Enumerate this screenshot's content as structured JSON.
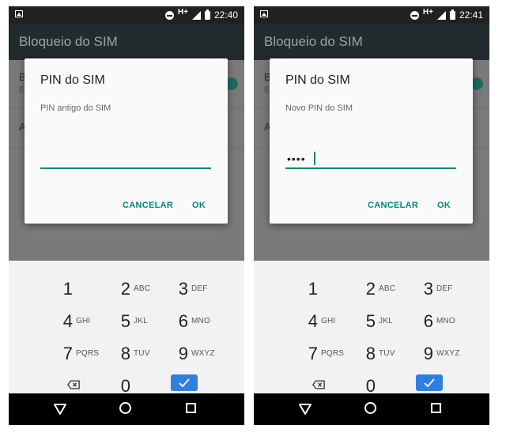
{
  "screens": [
    {
      "status": {
        "network": "H+",
        "time": "22:40"
      },
      "app_title": "Bloqueio do SIM",
      "settings_rows": [
        {
          "title": "B",
          "subtitle": "E"
        },
        {
          "title": "A"
        }
      ],
      "dialog": {
        "title": "PIN do SIM",
        "field_label": "PIN antigo do SIM",
        "input_value": "",
        "cancel_label": "CANCELAR",
        "ok_label": "OK"
      }
    },
    {
      "status": {
        "network": "H+",
        "time": "22:41"
      },
      "app_title": "Bloqueio do SIM",
      "settings_rows": [
        {
          "title": "B",
          "subtitle": "E"
        },
        {
          "title": "A"
        }
      ],
      "dialog": {
        "title": "PIN do SIM",
        "field_label": "Novo PIN do SIM",
        "input_value": "••••",
        "cancel_label": "CANCELAR",
        "ok_label": "OK"
      }
    }
  ],
  "keypad": {
    "keys": [
      {
        "num": "1",
        "letters": ""
      },
      {
        "num": "2",
        "letters": "ABC"
      },
      {
        "num": "3",
        "letters": "DEF"
      },
      {
        "num": "4",
        "letters": "GHI"
      },
      {
        "num": "5",
        "letters": "JKL"
      },
      {
        "num": "6",
        "letters": "MNO"
      },
      {
        "num": "7",
        "letters": "PQRS"
      },
      {
        "num": "8",
        "letters": "TUV"
      },
      {
        "num": "9",
        "letters": "WXYZ"
      },
      {
        "num": "0",
        "letters": ""
      }
    ],
    "icons": [
      "backspace-icon",
      "check-icon"
    ]
  },
  "navbar": {
    "icons": [
      "back-icon",
      "home-icon",
      "recents-icon"
    ]
  },
  "colors": {
    "accent": "#00897b",
    "done_key": "#2f7fe0",
    "status_bar": "#212121"
  }
}
